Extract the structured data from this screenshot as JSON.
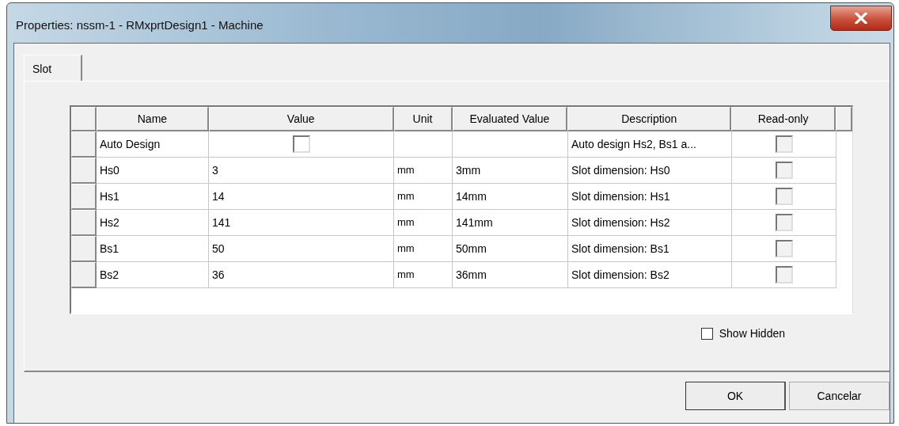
{
  "window": {
    "title": "Properties: nssm-1 - RMxprtDesign1 - Machine"
  },
  "tabs": [
    {
      "label": "Slot",
      "selected": true
    }
  ],
  "table": {
    "columns": [
      "Name",
      "Value",
      "Unit",
      "Evaluated Value",
      "Description",
      "Read-only"
    ],
    "rows": [
      {
        "kind": "checkbox",
        "name": "Auto Design",
        "checked": false,
        "description": "Auto design Hs2, Bs1 a...",
        "read_only": false
      },
      {
        "kind": "text",
        "name": "Hs0",
        "value": "3",
        "unit": "mm",
        "evaluated": "3mm",
        "description": "Slot dimension: Hs0",
        "read_only": false
      },
      {
        "kind": "text",
        "name": "Hs1",
        "value": "14",
        "unit": "mm",
        "evaluated": "14mm",
        "description": "Slot dimension: Hs1",
        "read_only": false
      },
      {
        "kind": "text",
        "name": "Hs2",
        "value": "141",
        "unit": "mm",
        "evaluated": "141mm",
        "description": "Slot dimension: Hs2",
        "read_only": false
      },
      {
        "kind": "text",
        "name": "Bs1",
        "value": "50",
        "unit": "mm",
        "evaluated": "50mm",
        "description": "Slot dimension: Bs1",
        "read_only": false
      },
      {
        "kind": "text",
        "name": "Bs2",
        "value": "36",
        "unit": "mm",
        "evaluated": "36mm",
        "description": "Slot dimension: Bs2",
        "read_only": false
      }
    ]
  },
  "show_hidden": {
    "label": "Show Hidden",
    "checked": false
  },
  "buttons": [
    {
      "label": "OK"
    },
    {
      "label": "Cancelar"
    }
  ]
}
